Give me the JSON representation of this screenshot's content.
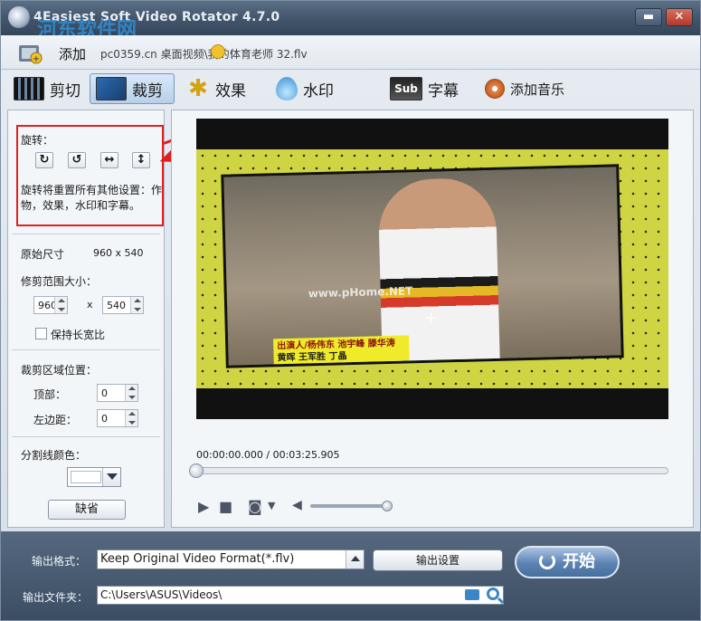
{
  "window": {
    "title": "4Easiest Soft Video Rotator 4.7.0",
    "watermark": "河东软件网",
    "min_glyph": "▬",
    "close_glyph": "✕"
  },
  "file_row": {
    "add_label": "添加",
    "path": "pc0359.cn 桌面视频\\我的!",
    "file_name": "体育老师 32.flv"
  },
  "tabs": [
    {
      "label": "剪切",
      "icon": "film-icon"
    },
    {
      "label": "裁剪",
      "icon": "screen-icon",
      "active": true
    },
    {
      "label": "效果",
      "icon": "star-icon"
    },
    {
      "label": "水印",
      "icon": "drop-icon"
    },
    {
      "label": "字幕",
      "icon": "subtitle-icon"
    },
    {
      "label": "添加音乐",
      "icon": "music-icon"
    }
  ],
  "left": {
    "rotate_label": "旋转：",
    "rotate_buttons": [
      "↻",
      "↺",
      "↔",
      "↕"
    ],
    "rotate_note": "旋转将重置所有其他设置：作物，效果，水印和字幕。",
    "original_size_label": "原始尺寸",
    "original_size_value": "960 x 540",
    "crop_size_label": "修剪范围大小：",
    "crop_width": "960",
    "crop_x": "x",
    "crop_height": "540",
    "keep_ratio_label": "保持长宽比",
    "crop_position_label": "裁剪区域位置：",
    "top_label": "顶部：",
    "top_value": "0",
    "left_label": "左边距：",
    "left_value": "0",
    "divider_color_label": "分割线颜色：",
    "default_button": "缺省"
  },
  "preview": {
    "caption_line1": "出演人/杨伟东 池宇峰 滕华涛",
    "caption_line2": "黄晖 王军胜 丁晶",
    "watermark_text": "www.pHome.NET",
    "timecode": "00:00:00.000 / 00:03:25.905"
  },
  "bottom": {
    "format_label": "输出格式：",
    "format_value": "Keep Original Video Format(*.flv)",
    "settings_button": "输出设置",
    "start_button": "开始",
    "folder_label": "输出文件夹：",
    "folder_value": "C:\\Users\\ASUS\\Videos\\"
  }
}
